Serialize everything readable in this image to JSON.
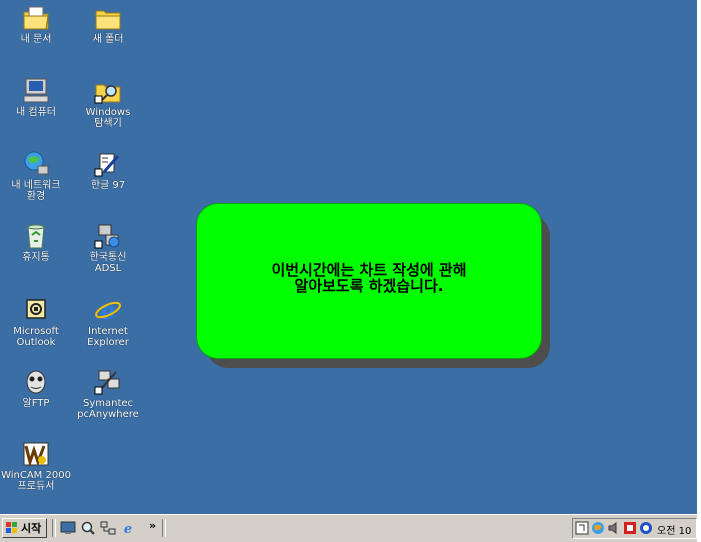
{
  "desktop": {
    "background_color": "#3a6ea5",
    "icons": [
      {
        "id": "my-documents",
        "label": "내 문서",
        "icon": "documents-folder-icon"
      },
      {
        "id": "new-folder",
        "label": "새 폴더",
        "icon": "folder-icon"
      },
      {
        "id": "my-computer",
        "label": "내 컴퓨터",
        "icon": "computer-icon"
      },
      {
        "id": "windows-explorer",
        "label_lines": [
          "Windows",
          "탐색기"
        ],
        "icon": "explorer-icon"
      },
      {
        "id": "network-places",
        "label_lines": [
          "내 네트워크",
          "환경"
        ],
        "icon": "network-icon"
      },
      {
        "id": "hangul-97",
        "label": "한글 97",
        "icon": "hangul-icon"
      },
      {
        "id": "recycle-bin",
        "label": "휴지통",
        "icon": "recycle-bin-icon"
      },
      {
        "id": "korea-telecom-adsl",
        "label_lines": [
          "한국통신",
          "ADSL"
        ],
        "icon": "network-connection-icon"
      },
      {
        "id": "microsoft-outlook",
        "label_lines": [
          "Microsoft",
          "Outlook"
        ],
        "icon": "outlook-icon"
      },
      {
        "id": "internet-explorer",
        "label_lines": [
          "Internet",
          "Explorer"
        ],
        "icon": "internet-explorer-icon"
      },
      {
        "id": "alftp",
        "label": "알FTP",
        "icon": "alftp-icon"
      },
      {
        "id": "pcanywhere",
        "label_lines": [
          "Symantec",
          "pcAnywhere"
        ],
        "icon": "pcanywhere-icon"
      },
      {
        "id": "wincam-2000",
        "label_lines": [
          "WinCAM 2000",
          "프로듀서"
        ],
        "icon": "wincam-icon"
      }
    ]
  },
  "callout": {
    "line1": "이번시간에는 차트 작성에 관해",
    "line2": "알아보도록 하겠습니다.",
    "fill_color": "#00ff00"
  },
  "taskbar": {
    "start_label": "시작",
    "quick_launch": [
      "show-desktop-icon",
      "search-icon",
      "network-icon",
      "internet-explorer-icon"
    ],
    "more_label": "»",
    "tray_icons": [
      "ime-icon",
      "network-icon",
      "speaker-icon",
      "virus-shield-icon",
      "messenger-icon"
    ],
    "clock": "오전 10"
  }
}
